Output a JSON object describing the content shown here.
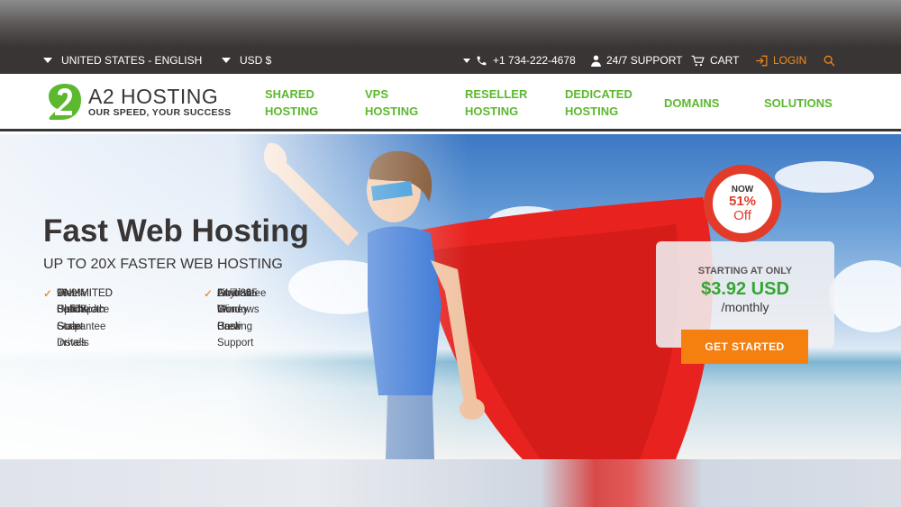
{
  "topbar": {
    "region": "UNITED STATES - ENGLISH",
    "currency": "USD $",
    "phone": "+1 734-222-4678",
    "support": "24/7 SUPPORT",
    "cart": "CART",
    "login": "LOGIN"
  },
  "logo": {
    "name": "A2 HOSTING",
    "tagline": "OUR SPEED, YOUR SUCCESS"
  },
  "nav": [
    {
      "line1": "SHARED",
      "line2": "HOSTING"
    },
    {
      "line1": "VPS",
      "line2": "HOSTING"
    },
    {
      "line1": "RESELLER",
      "line2": "HOSTING"
    },
    {
      "line1": "DEDICATED",
      "line2": "HOSTING"
    },
    {
      "line1": "DOMAINS",
      "line2": ""
    },
    {
      "line1": "SOLUTIONS",
      "line2": ""
    }
  ],
  "hero": {
    "title": "Fast Web Hosting",
    "subtitle": "UP TO 20X FASTER WEB HOSTING",
    "features_left": [
      "UNLIMITED Disk Space",
      "UNLIMITED Bandwidth",
      "1-CLICK Script Installs",
      "Free Solid State Drives",
      "99.9% Uptime Guarantee"
    ],
    "features_right": [
      "Linux & Windows Hosting",
      "24/7/365 Guru Crew Support",
      "Anytime Money Back",
      "Guarantee"
    ]
  },
  "offer": {
    "badge_now": "NOW",
    "badge_percent": "51%",
    "badge_off": "Off",
    "starting_at": "STARTING AT ONLY",
    "price": "$3.92 USD",
    "period": "/monthly",
    "cta": "GET STARTED"
  },
  "colors": {
    "brand_green": "#5cb82e",
    "accent_orange": "#f57f0f",
    "badge_red": "#e23b2a",
    "dark": "#3a3535"
  }
}
